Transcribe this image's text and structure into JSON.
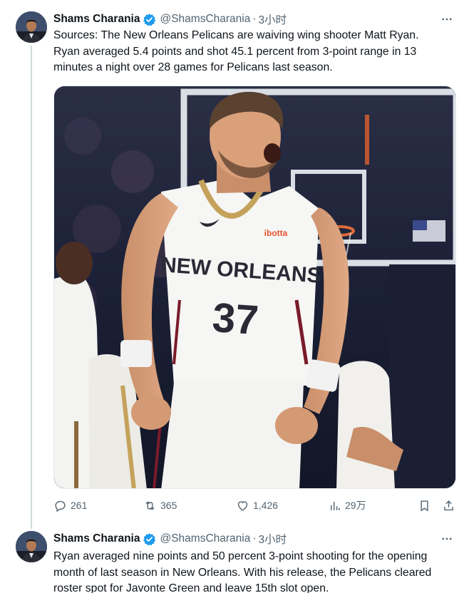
{
  "tweets": [
    {
      "author": {
        "name": "Shams Charania",
        "handle": "@ShamsCharania",
        "time": "3小时"
      },
      "text_lines": [
        "Sources: The New Orleans Pelicans are waiving wing shooter Matt Ryan.",
        "Ryan averaged 5.4 points and shot 45.1 percent from 3-point range in 13",
        "minutes a night over 28 games for Pelicans last season."
      ],
      "media": {
        "jersey_team": "NEW ORLEANS",
        "jersey_number": "37",
        "sponsor": "ibotta"
      },
      "actions": {
        "replies": "261",
        "retweets": "365",
        "likes": "1,426",
        "views": "29万"
      }
    },
    {
      "author": {
        "name": "Shams Charania",
        "handle": "@ShamsCharania",
        "time": "3小时"
      },
      "text_lines": [
        "Ryan averaged nine points and 50 percent 3-point shooting for the opening",
        "month of last season in New Orleans. With his release, the Pelicans cleared",
        "roster spot for Javonte Green and leave 15th slot open."
      ]
    }
  ],
  "colors": {
    "verified": "#1d9bf0",
    "muted": "#536471",
    "thread_line": "#cfd9de"
  },
  "icons": [
    "verified-badge-icon",
    "more-icon",
    "reply-icon",
    "retweet-icon",
    "like-icon",
    "views-icon",
    "bookmark-icon",
    "share-icon"
  ]
}
